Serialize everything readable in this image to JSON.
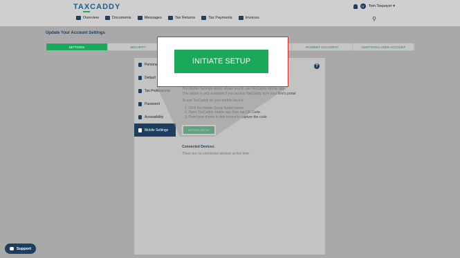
{
  "header": {
    "logo": "TAXCADDY",
    "user_initials": "TT",
    "user_name": "Tom Taxpayer ▾",
    "nav": [
      "Overview",
      "Documents",
      "Messages",
      "Tax Returns",
      "Tax Payments",
      "Invoices"
    ],
    "search_icon": "search-icon"
  },
  "page": {
    "title": "Update Your Account Settings",
    "tabs": [
      "SETTINGS",
      "SECURITY",
      "",
      "",
      "PAYMENT ACCOUNTS",
      "ADDITIONAL USER ACCOUNT"
    ]
  },
  "sidebar": {
    "items": [
      "Personal",
      "Default",
      "Tax Professional",
      "Password",
      "Accessibility",
      "Mobile Settings"
    ]
  },
  "content": {
    "intro_1": "The Mobile Settings option allows you to use TaxCaddy mobile app.",
    "intro_2": "This option is only available if you access TaxCaddy from your firm's portal",
    "steps_title": "To use TaxCaddy on your mobile device:",
    "step_1": "1. Click the Initiate Setup button below.",
    "step_2": "2. Open TaxCaddy mobile app then tap QR Code.",
    "step_3": "3. Point your phone to this screen to capture the code.",
    "button_small": "INITIATE SETUP",
    "devices_title": "Connected Devices:",
    "devices_empty": "There are no connected devices at this time."
  },
  "zoom": {
    "button_label": "INITIATE SETUP"
  },
  "support": {
    "label": "Support"
  },
  "colors": {
    "brand_green": "#1ba85a",
    "navy": "#1d3e5e",
    "highlight_border": "#d32c2c"
  }
}
